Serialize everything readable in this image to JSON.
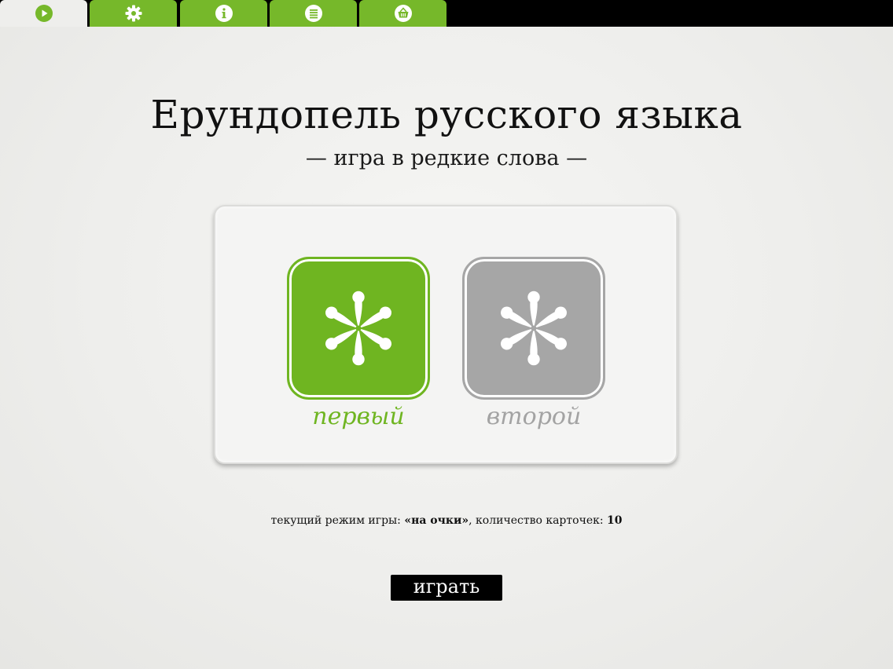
{
  "tabs": [
    {
      "icon": "play-icon",
      "active": true
    },
    {
      "icon": "gear-icon",
      "active": false
    },
    {
      "icon": "info-icon",
      "active": false
    },
    {
      "icon": "list-icon",
      "active": false
    },
    {
      "icon": "basket-icon",
      "active": false
    }
  ],
  "title": "Ерундопель русского языка",
  "subtitle": "— игра в редкие слова —",
  "players": {
    "first_label": "первый",
    "second_label": "второй",
    "first_icon": "asterisk-flower-icon",
    "second_icon": "asterisk-flower-icon",
    "first_color": "#6fb521",
    "second_color": "#a6a6a6"
  },
  "status": {
    "mode_prefix": "текущий режим игры: ",
    "mode_value": "«на очки»",
    "count_prefix": ", количество карточек: ",
    "count_value": "10"
  },
  "play_button_label": "играть",
  "colors": {
    "accent": "#76b82a",
    "background": "#eeeeec",
    "topbar": "#000000"
  }
}
